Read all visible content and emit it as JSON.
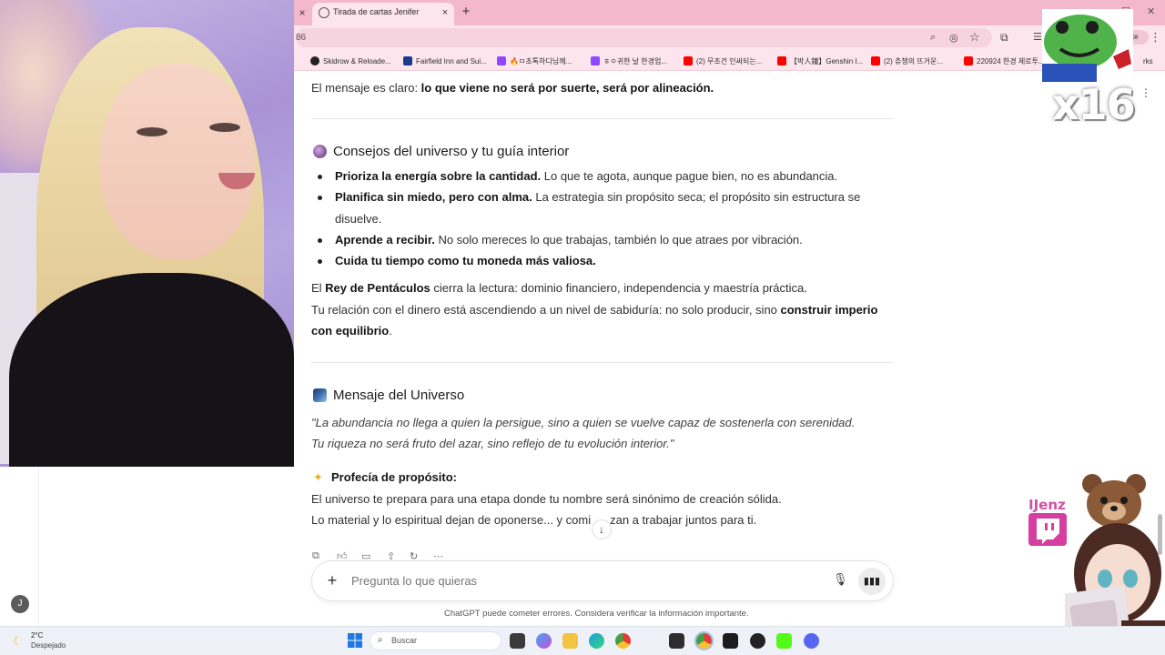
{
  "browser": {
    "tab_title": "Tirada de cartas Jenifer",
    "tab_close_left": "×",
    "tab_close": "×",
    "new_tab": "+",
    "url_fragment": "86",
    "update_label": "date",
    "bookmarks": [
      {
        "label": "Skidrow & Reloade...",
        "color": "#222222"
      },
      {
        "label": "Fairfield Inn and Sui...",
        "color": "#1b3a8a"
      },
      {
        "label": "🔥ㅁ초톡하디님께...",
        "color": "#9146ff"
      },
      {
        "label": "ㅎㅇ귀한 날 한경업...",
        "color": "#9146ff"
      },
      {
        "label": "(2) 무조건 인싸되는...",
        "color": "#ff0000"
      },
      {
        "label": "【박人鐘】Genshin I...",
        "color": "#ff0000"
      },
      {
        "label": "(2) 츄챙의 뜨거운...",
        "color": "#ff0000"
      },
      {
        "label": "220924 한경 제로투...",
        "color": "#ff0000"
      },
      {
        "label": "rks",
        "color": "#888888"
      }
    ]
  },
  "chat": {
    "line_intro": {
      "pre": "El mensaje es claro: ",
      "bold": "lo que viene no será por suerte, será por alineación."
    },
    "section1_title": "Consejos del universo y tu guía interior",
    "bullets": [
      {
        "bold": "Prioriza la energía sobre la cantidad.",
        "rest": " Lo que te agota, aunque pague bien, no es abundancia."
      },
      {
        "bold": "Planifica sin miedo, pero con alma.",
        "rest": " La estrategia sin propósito seca; el propósito sin estructura se"
      },
      {
        "bold": "",
        "rest": "disuelve."
      },
      {
        "bold": "Aprende a recibir.",
        "rest": " No solo mereces lo que trabajas, también lo que atraes por vibración."
      },
      {
        "bold": "Cuida tu tiempo como tu moneda más valiosa.",
        "rest": ""
      }
    ],
    "rey": {
      "pre": "El ",
      "bold": "Rey de Pentáculos",
      "post": " cierra la lectura: dominio financiero, independencia y maestría práctica."
    },
    "relacion_1": {
      "pre": "Tu relación con el dinero está ascendiendo a un nivel de sabiduría: no solo producir, sino ",
      "bold": "construir imperio"
    },
    "relacion_2": {
      "bold": "con equilibrio",
      "post": "."
    },
    "section2_title": "Mensaje del Universo",
    "quote_1": "\"La abundancia no llega a quien la persigue, sino a quien se vuelve capaz de sostenerla con serenidad.",
    "quote_2": "Tu riqueza no será fruto del azar, sino reflejo de tu evolución interior.\"",
    "section3_title": "Profecía de propósito:",
    "profecia_1": "El universo te prepara para una etapa donde tu nombre será sinónimo de creación sólida.",
    "profecia_2a": "Lo material y lo espiritual dejan de oponerse... y comi",
    "profecia_2b": "zan a trabajar juntos para ti.",
    "scroll_down": "↓",
    "composer_placeholder": "Pregunta lo que quieras",
    "composer_plus": "+",
    "disclaimer": "ChatGPT puede cometer errores. Considera verificar la información importante.",
    "avatar_letter": "J",
    "action_icons": [
      "copy-icon",
      "thumbs-up-icon",
      "thumbs-down-icon",
      "share-icon",
      "regenerate-icon",
      "more-icon"
    ]
  },
  "overlay": {
    "multiplier": "x16",
    "twitch_name": "IJenz",
    "right_dots": "⋮"
  },
  "taskbar": {
    "temp": "2°C",
    "weather": "Despejado",
    "search_placeholder": "Buscar"
  },
  "colors": {
    "tab_bar": "#f4b8cc",
    "toolbar": "#fde5ee",
    "twitch": "#d63fa1",
    "accent_pink": "#d44fa6"
  }
}
